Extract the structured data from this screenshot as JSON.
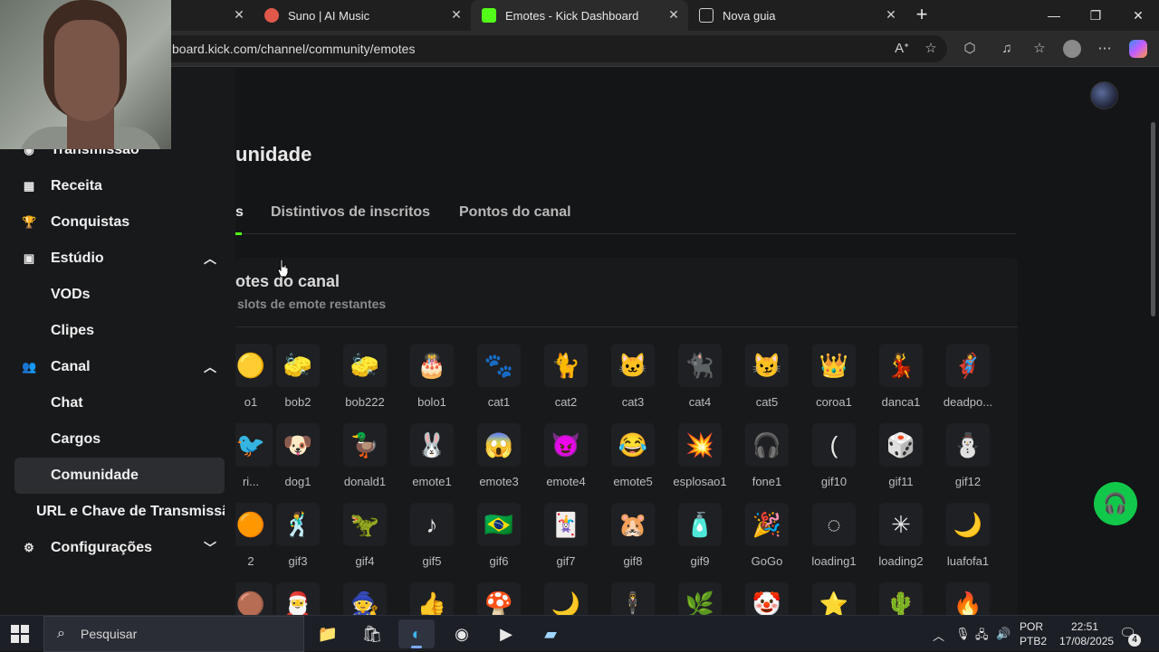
{
  "browser": {
    "tabs": [
      {
        "title": "",
        "favicon_color": "#4a4a4a"
      },
      {
        "title": "Suno | AI Music",
        "favicon_color": "#e0584a"
      },
      {
        "title": "Emotes - Kick Dashboard",
        "favicon_color": "#53fc18",
        "active": true
      },
      {
        "title": "Nova guia",
        "favicon_color": "#cfcfcf"
      }
    ],
    "url": "board.kick.com/channel/community/emotes",
    "close_glyph": "✕",
    "new_tab_glyph": "+"
  },
  "sidebar": {
    "items": [
      {
        "label": "Transmissão",
        "icon": "play-circle-icon"
      },
      {
        "label": "Receita",
        "icon": "chart-icon"
      },
      {
        "label": "Conquistas",
        "icon": "trophy-icon"
      },
      {
        "label": "Estúdio",
        "icon": "studio-icon",
        "expanded": true
      },
      {
        "label": "VODs"
      },
      {
        "label": "Clipes"
      },
      {
        "label": "Canal",
        "icon": "users-icon",
        "expanded": true
      },
      {
        "label": "Chat"
      },
      {
        "label": "Cargos"
      },
      {
        "label": "Comunidade",
        "active": true
      },
      {
        "label": "URL e Chave de Transmissão"
      },
      {
        "label": "Configurações",
        "icon": "gear-icon",
        "expanded": false
      }
    ]
  },
  "main": {
    "title": "unidade",
    "tabs": [
      "s",
      "Distintivos de inscritos",
      "Pontos do canal"
    ],
    "panel": {
      "title": "otes do canal",
      "subtitle": "slots de emote restantes"
    },
    "emotes": [
      [
        {
          "name": "o1",
          "glyph": "🟡"
        },
        {
          "name": "bob2",
          "glyph": "🧽"
        },
        {
          "name": "bob222",
          "glyph": "🧽"
        },
        {
          "name": "bolo1",
          "glyph": "🎂"
        },
        {
          "name": "cat1",
          "glyph": "🐾"
        },
        {
          "name": "cat2",
          "glyph": "🐈"
        },
        {
          "name": "cat3",
          "glyph": "🐱"
        },
        {
          "name": "cat4",
          "glyph": "🐈‍⬛"
        },
        {
          "name": "cat5",
          "glyph": "😼"
        },
        {
          "name": "coroa1",
          "glyph": "👑"
        },
        {
          "name": "danca1",
          "glyph": "💃"
        },
        {
          "name": "deadpo...",
          "glyph": "🦸"
        }
      ],
      [
        {
          "name": "ri...",
          "glyph": "🐦"
        },
        {
          "name": "dog1",
          "glyph": "🐶"
        },
        {
          "name": "donald1",
          "glyph": "🦆"
        },
        {
          "name": "emote1",
          "glyph": "🐰"
        },
        {
          "name": "emote3",
          "glyph": "😱"
        },
        {
          "name": "emote4",
          "glyph": "😈"
        },
        {
          "name": "emote5",
          "glyph": "😂"
        },
        {
          "name": "esplosao1",
          "glyph": "💥"
        },
        {
          "name": "fone1",
          "glyph": "🎧"
        },
        {
          "name": "gif10",
          "glyph": "("
        },
        {
          "name": "gif11",
          "glyph": "🎲"
        },
        {
          "name": "gif12",
          "glyph": "⛄"
        }
      ],
      [
        {
          "name": "2",
          "glyph": "🟠"
        },
        {
          "name": "gif3",
          "glyph": "🕺"
        },
        {
          "name": "gif4",
          "glyph": "🦖"
        },
        {
          "name": "gif5",
          "glyph": "♪"
        },
        {
          "name": "gif6",
          "glyph": "🇧🇷"
        },
        {
          "name": "gif7",
          "glyph": "🃏"
        },
        {
          "name": "gif8",
          "glyph": "🐹"
        },
        {
          "name": "gif9",
          "glyph": "🧴"
        },
        {
          "name": "GoGo",
          "glyph": "🎉"
        },
        {
          "name": "loading1",
          "glyph": "◌"
        },
        {
          "name": "loading2",
          "glyph": "✳"
        },
        {
          "name": "luafofa1",
          "glyph": "🌙"
        }
      ],
      [
        {
          "name": "",
          "glyph": "🟤"
        },
        {
          "name": "",
          "glyph": "🎅"
        },
        {
          "name": "",
          "glyph": "🧙"
        },
        {
          "name": "",
          "glyph": "👍"
        },
        {
          "name": "",
          "glyph": "🍄"
        },
        {
          "name": "",
          "glyph": "🌙"
        },
        {
          "name": "",
          "glyph": "🕴"
        },
        {
          "name": "",
          "glyph": "🌿"
        },
        {
          "name": "",
          "glyph": "🤡"
        },
        {
          "name": "",
          "glyph": "⭐"
        },
        {
          "name": "",
          "glyph": "🌵"
        },
        {
          "name": "",
          "glyph": "🔥"
        }
      ]
    ]
  },
  "taskbar": {
    "search_placeholder": "Pesquisar",
    "lang_line1": "POR",
    "lang_line2": "PTB2",
    "time": "22:51",
    "date": "17/08/2025",
    "notifications": "4"
  },
  "colors": {
    "kick_green": "#53fc18",
    "help_button": "#12c84a"
  }
}
